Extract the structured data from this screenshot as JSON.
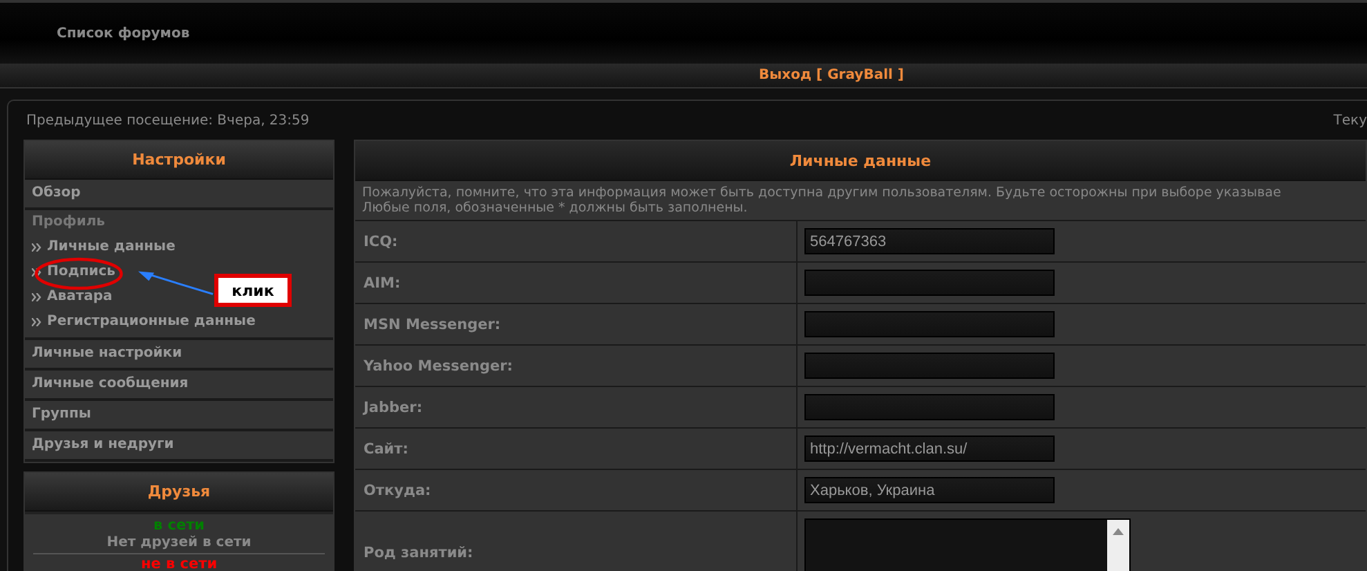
{
  "header": {
    "nav_link": "Список форумов"
  },
  "user_bar": {
    "logout": "Выход [ GrayBall ]"
  },
  "info_bar": {
    "last_visit": "Предыдущее посещение: Вчера, 23:59",
    "current_time": "Теку"
  },
  "sidebar": {
    "title": "Настройки",
    "sections": [
      {
        "label": "Обзор",
        "kind": "link"
      },
      {
        "label": "Профиль",
        "kind": "group",
        "children": [
          {
            "label": "Личные данные"
          },
          {
            "label": "Подпись"
          },
          {
            "label": "Аватара"
          },
          {
            "label": "Регистрационные данные"
          }
        ]
      },
      {
        "label": "Личные настройки",
        "kind": "link"
      },
      {
        "label": "Личные сообщения",
        "kind": "link"
      },
      {
        "label": "Группы",
        "kind": "link"
      },
      {
        "label": "Друзья и недруги",
        "kind": "link"
      }
    ]
  },
  "friends": {
    "title": "Друзья",
    "groups": [
      {
        "label": "в сети",
        "color": "#008000",
        "empty": "Нет друзей в сети"
      },
      {
        "label": "не в сети",
        "color": "#ff0000"
      }
    ]
  },
  "annotation": {
    "label": "клик"
  },
  "form": {
    "title": "Личные данные",
    "notice": "Пожалуйста, помните, что эта информация может быть доступна другим пользователям. Будьте осторожны при выборе указывае",
    "notice2": "Любые поля, обозначенные * должны быть заполнены.",
    "fields": [
      {
        "label": "ICQ:",
        "kind": "text",
        "value": "564767363"
      },
      {
        "label": "AIM:",
        "kind": "text"
      },
      {
        "label": "MSN Messenger:",
        "kind": "text"
      },
      {
        "label": "Yahoo Messenger:",
        "kind": "text"
      },
      {
        "label": "Jabber:",
        "kind": "text"
      },
      {
        "label": "Сайт:",
        "kind": "text",
        "value": "http://vermacht.clan.su/"
      },
      {
        "label": "Откуда:",
        "kind": "text",
        "value": "Харьков, Украина"
      },
      {
        "label": "Род занятий:",
        "kind": "textarea"
      }
    ]
  }
}
